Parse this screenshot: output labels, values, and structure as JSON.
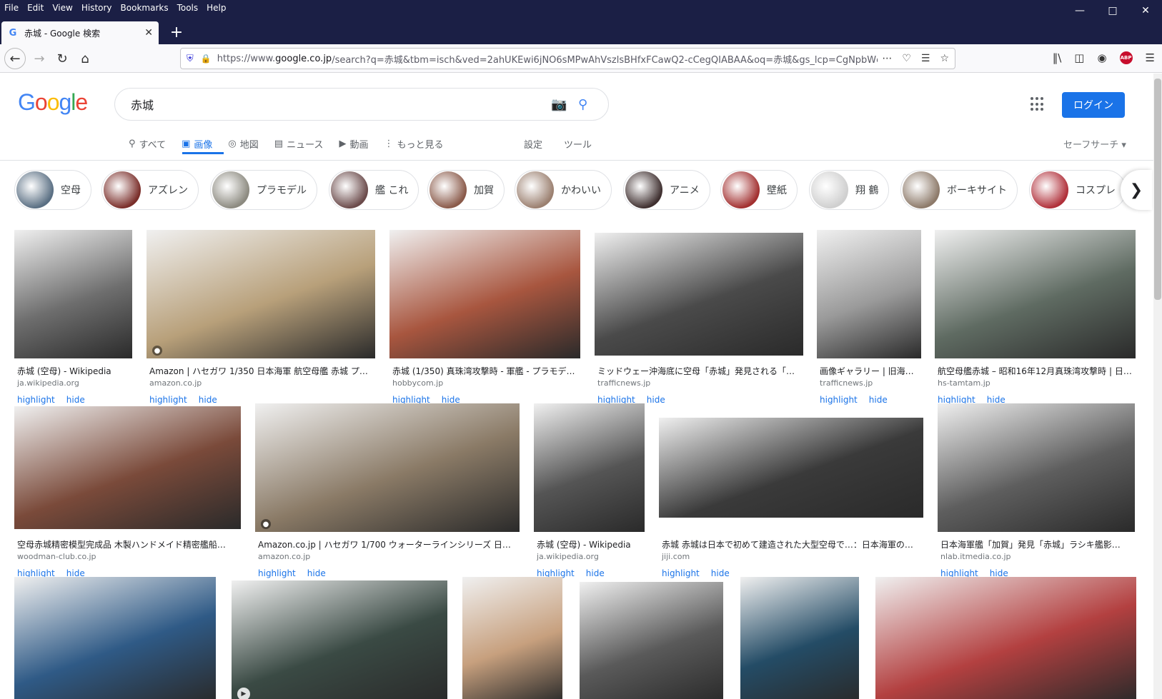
{
  "browser": {
    "menu": [
      "File",
      "Edit",
      "View",
      "History",
      "Bookmarks",
      "Tools",
      "Help"
    ],
    "tab_title": "赤城 - Google 検索",
    "url_prefix": "https://www.",
    "url_host": "google.co.jp",
    "url_rest": "/search?q=赤城&tbm=isch&ved=2ahUKEwi6jNO6sMPwAhVszlsBHfxFCawQ2-cCegQIABAA&oq=赤城&gs_lcp=CgNpbWcQAz",
    "abp_label": "ABP"
  },
  "google": {
    "logo": [
      "G",
      "o",
      "o",
      "g",
      "l",
      "e"
    ],
    "query": "赤城",
    "login": "ログイン",
    "tabs": [
      {
        "label": "すべて",
        "icon": "search-icon"
      },
      {
        "label": "画像",
        "icon": "image-icon"
      },
      {
        "label": "地図",
        "icon": "map-pin-icon"
      },
      {
        "label": "ニュース",
        "icon": "news-icon"
      },
      {
        "label": "動画",
        "icon": "video-icon"
      },
      {
        "label": "もっと見る",
        "icon": "more-vert-icon"
      }
    ],
    "settings": "設定",
    "tools": "ツール",
    "safesearch": "セーフサーチ ▾"
  },
  "chips": [
    {
      "label": "空母",
      "color": "#5a6f83"
    },
    {
      "label": "アズレン",
      "color": "#7a2e2a"
    },
    {
      "label": "プラモデル",
      "color": "#8c8a80"
    },
    {
      "label": "艦 これ",
      "color": "#6b4b4b"
    },
    {
      "label": "加賀",
      "color": "#8a5a4a"
    },
    {
      "label": "かわいい",
      "color": "#9b8070"
    },
    {
      "label": "アニメ",
      "color": "#3f3030"
    },
    {
      "label": "壁紙",
      "color": "#a23030"
    },
    {
      "label": "翔 鶴",
      "color": "#cfcfcf"
    },
    {
      "label": "ボーキサイト",
      "color": "#8d7a6a"
    },
    {
      "label": "コスプレ",
      "color": "#b0303a"
    }
  ],
  "results_row1": [
    {
      "title": "赤城 (空母) - Wikipedia",
      "source": "ja.wikipedia.org",
      "color": "#6e6e6e"
    },
    {
      "title": "Amazon | ハセガワ 1/350 日本海軍 航空母艦 赤城 プラ…",
      "source": "amazon.co.jp",
      "color": "#b8a07a"
    },
    {
      "title": "赤城 (1/350) 真珠湾攻撃時 - 軍艦 - プラモデル…",
      "source": "hobbycom.jp",
      "color": "#a8563f"
    },
    {
      "title": "ミッドウェー沖海底に空母「赤城」発見される「…",
      "source": "trafficnews.jp",
      "color": "#4a4a4a"
    },
    {
      "title": "画像ギャラリー | 旧海…",
      "source": "trafficnews.jp",
      "color": "#9a9a9a"
    },
    {
      "title": "航空母艦赤城 – 昭和16年12月真珠湾攻撃時 | 日…",
      "source": "hs-tamtam.jp",
      "color": "#5f6b62"
    }
  ],
  "results_row2": [
    {
      "title": "空母赤城精密模型完成品 木製ハンドメイド精密艦船…",
      "source": "woodman-club.co.jp",
      "color": "#7a4a3a"
    },
    {
      "title": "Amazon.co.jp | ハセガワ 1/700 ウォーターラインシリーズ 日本…",
      "source": "amazon.co.jp",
      "color": "#8a7a66"
    },
    {
      "title": "赤城 (空母) - Wikipedia",
      "source": "ja.wikipedia.org",
      "color": "#555555"
    },
    {
      "title": "赤城 赤城は日本で初めて建造された大型空母で…：日本海軍の航…",
      "source": "jiji.com",
      "color": "#3a3a3a"
    },
    {
      "title": "日本海軍艦「加賀」発見「赤城」ラシキ艦影…",
      "source": "nlab.itmedia.co.jp",
      "color": "#5e5e5e"
    }
  ],
  "results_row3": [
    {
      "color": "#2f5a86"
    },
    {
      "color": "#3a4a44"
    },
    {
      "color": "#c7a07e"
    },
    {
      "color": "#5a5a5a"
    },
    {
      "color": "#244c66"
    },
    {
      "color": "#b34040"
    }
  ],
  "card_actions": {
    "highlight": "highlight",
    "hide": "hide"
  }
}
